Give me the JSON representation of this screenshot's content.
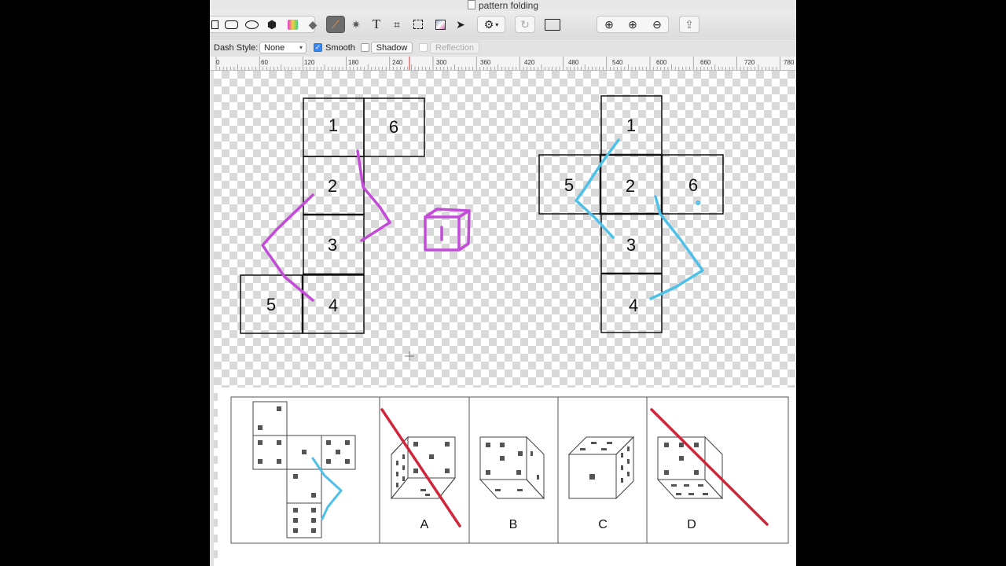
{
  "window": {
    "title": "pattern folding"
  },
  "toolbar": {
    "tools": [
      "rect-icon",
      "rounded-rect-icon",
      "ellipse-icon",
      "polygon-icon",
      "gradient-icon",
      "eraser-icon",
      "pencil-icon",
      "magic-wand-icon",
      "text-icon",
      "crop-icon",
      "marquee-icon",
      "image-adjust-icon",
      "pointer-icon",
      "gear-icon",
      "rotate-icon",
      "image-size-icon",
      "zoom-fit-icon",
      "zoom-in-icon",
      "zoom-out-icon",
      "share-icon"
    ],
    "text_tool": "T"
  },
  "options": {
    "dash_style_label": "Dash Style:",
    "dash_style_value": "None",
    "smooth_label": "Smooth",
    "smooth_checked": true,
    "shadow_label": "Shadow",
    "shadow_checked": false,
    "reflection_label": "Reflection",
    "reflection_checked": false
  },
  "ruler": {
    "labels": [
      "0",
      "60",
      "120",
      "180",
      "240",
      "300",
      "360",
      "420",
      "480",
      "540",
      "600",
      "660",
      "720",
      "780"
    ]
  },
  "canvas": {
    "net_left": {
      "faces": [
        "1",
        "6",
        "2",
        "3",
        "5",
        "4"
      ]
    },
    "net_right": {
      "faces": [
        "1",
        "5",
        "2",
        "6",
        "3",
        "4"
      ]
    },
    "answer_options": [
      "A",
      "B",
      "C",
      "D"
    ],
    "colors": {
      "magenta": "#c24bd8",
      "cyan": "#4fc0e8",
      "red": "#d0253a"
    }
  }
}
